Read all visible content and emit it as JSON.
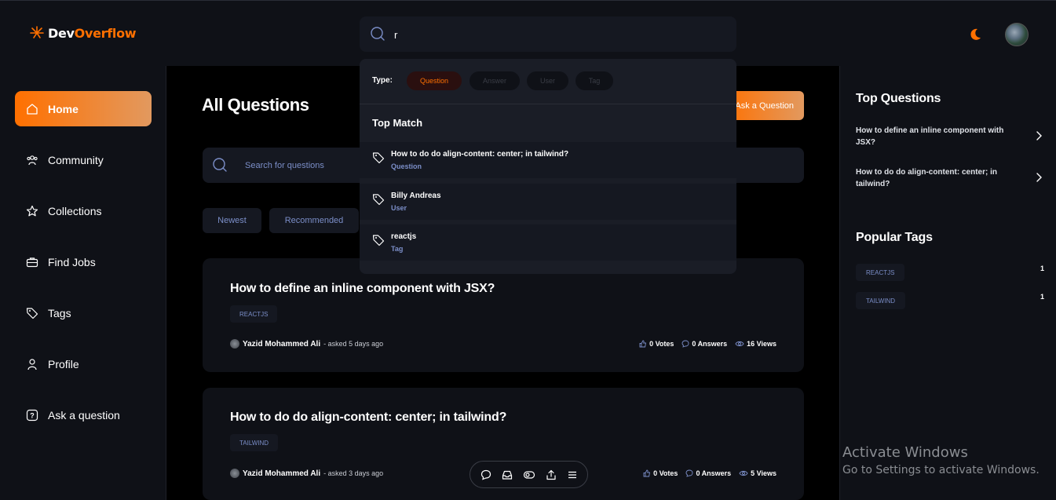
{
  "brand": {
    "part1": "Dev",
    "part2": "Overflow"
  },
  "header": {
    "search_value": "r"
  },
  "sidebar": {
    "items": [
      {
        "label": "Home",
        "icon": "home-icon"
      },
      {
        "label": "Community",
        "icon": "users-icon"
      },
      {
        "label": "Collections",
        "icon": "star-icon"
      },
      {
        "label": "Find Jobs",
        "icon": "briefcase-icon"
      },
      {
        "label": "Tags",
        "icon": "tag-icon"
      },
      {
        "label": "Profile",
        "icon": "user-icon"
      },
      {
        "label": "Ask a question",
        "icon": "question-icon"
      }
    ]
  },
  "main": {
    "title": "All Questions",
    "ask_button": "Ask a Question",
    "search_placeholder": "Search for questions",
    "filters": [
      "Newest",
      "Recommended"
    ],
    "questions": [
      {
        "title": "How to define an inline component with JSX?",
        "tag": "REACTJS",
        "author": "Yazid Mohammed Ali",
        "asked": "- asked 5 days ago",
        "votes": "0 Votes",
        "answers": "0 Answers",
        "views": "16 Views"
      },
      {
        "title": "How to do do align-content: center; in tailwind?",
        "tag": "TAILWIND",
        "author": "Yazid Mohammed Ali",
        "asked": "- asked 3 days ago",
        "votes": "0 Votes",
        "answers": "0 Answers",
        "views": "5 Views"
      }
    ]
  },
  "dropdown": {
    "type_label": "Type:",
    "types": [
      "Question",
      "Answer",
      "User",
      "Tag"
    ],
    "active_type": "Question",
    "top_match_label": "Top Match",
    "results": [
      {
        "title": "How to do do align-content: center; in tailwind?",
        "kind": "Question"
      },
      {
        "title": "Billy Andreas",
        "kind": "User"
      },
      {
        "title": "reactjs",
        "kind": "Tag"
      }
    ]
  },
  "rightbar": {
    "top_questions_heading": "Top Questions",
    "top_questions": [
      "How to define an inline component with JSX?",
      "How to do do align-content: center; in tailwind?"
    ],
    "popular_tags_heading": "Popular Tags",
    "popular_tags": [
      {
        "name": "REACTJS",
        "count": "1"
      },
      {
        "name": "TAILWIND",
        "count": "1"
      }
    ]
  },
  "watermark": {
    "line1": "Activate Windows",
    "line2": "Go to Settings to activate Windows."
  },
  "colors": {
    "accent": "#ff7000",
    "accent_end": "#e2995f",
    "panel": "#0f1117",
    "muted_blue": "#7b8ec8"
  }
}
